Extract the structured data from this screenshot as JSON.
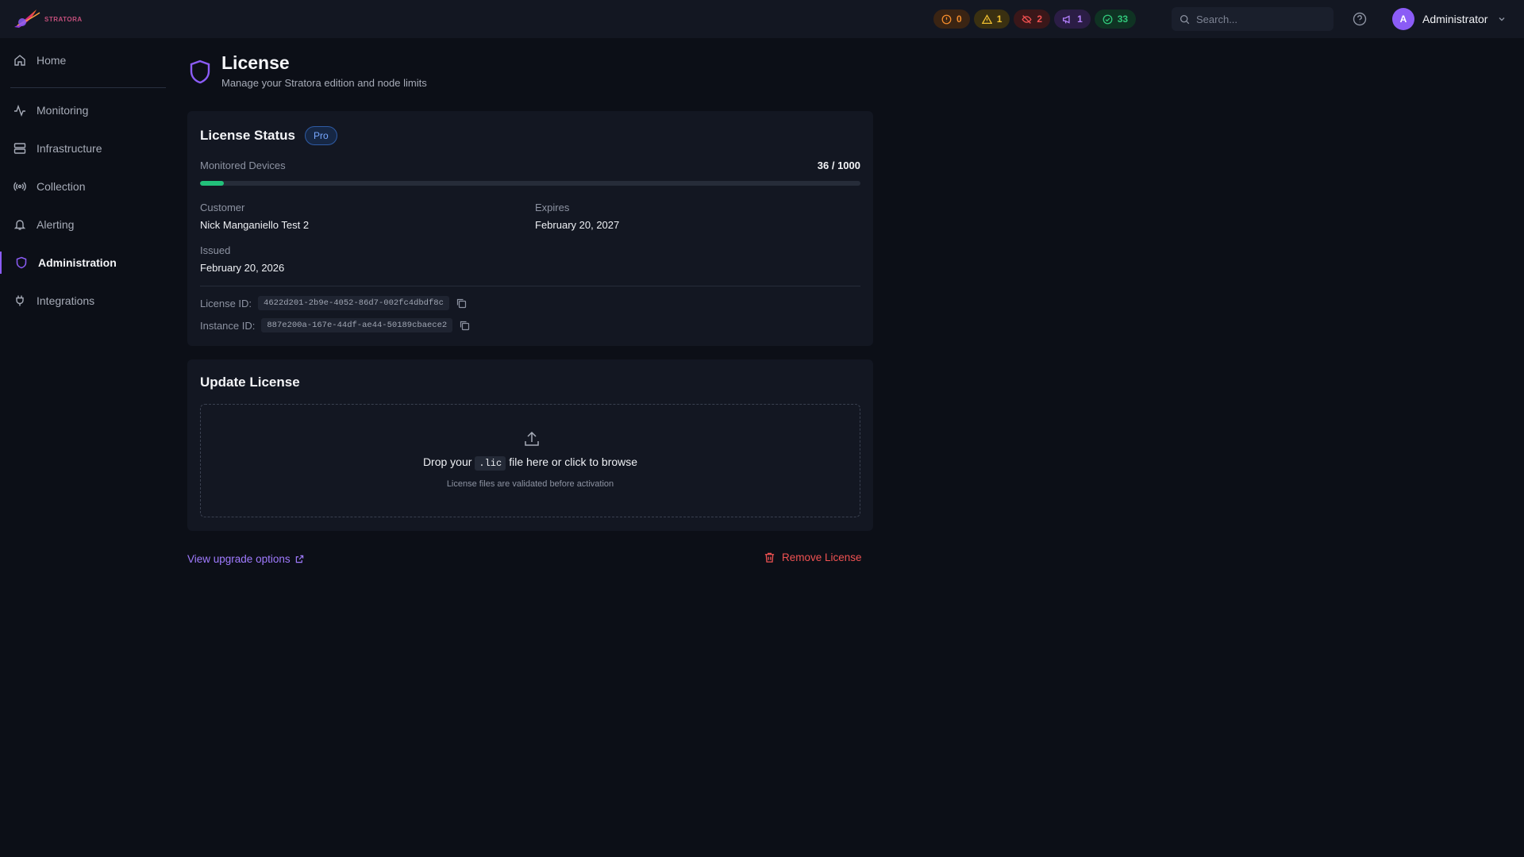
{
  "app": {
    "brand": "STRATORA"
  },
  "header": {
    "counters": [
      {
        "icon": "alert-circle-icon",
        "value": "0",
        "color": "#f08a2c"
      },
      {
        "icon": "warning-triangle-icon",
        "value": "1",
        "color": "#f0c030"
      },
      {
        "icon": "eye-off-icon",
        "value": "2",
        "color": "#f05050"
      },
      {
        "icon": "megaphone-icon",
        "value": "1",
        "color": "#b481ff"
      },
      {
        "icon": "check-circle-icon",
        "value": "33",
        "color": "#31c77a"
      }
    ],
    "search_placeholder": "Search...",
    "user": {
      "initial": "A",
      "name": "Administrator"
    }
  },
  "sidebar": {
    "items": [
      {
        "label": "Home",
        "icon": "home-icon"
      },
      {
        "label": "Monitoring",
        "icon": "activity-icon"
      },
      {
        "label": "Infrastructure",
        "icon": "server-icon"
      },
      {
        "label": "Collection",
        "icon": "broadcast-icon"
      },
      {
        "label": "Alerting",
        "icon": "bell-icon"
      },
      {
        "label": "Administration",
        "icon": "shield-icon",
        "active": true
      },
      {
        "label": "Integrations",
        "icon": "plug-icon"
      }
    ]
  },
  "page": {
    "title": "License",
    "subtitle": "Manage your Stratora edition and node limits"
  },
  "license_status": {
    "title": "License Status",
    "edition_badge": "Pro",
    "devices_label": "Monitored Devices",
    "devices_count": "36 / 1000",
    "devices_used_fraction": 0.036,
    "customer_label": "Customer",
    "customer": "Nick Manganiello Test 2",
    "expires_label": "Expires",
    "expires": "February 20, 2027",
    "issued_label": "Issued",
    "issued": "February 20, 2026",
    "license_id_label": "License ID:",
    "license_id": "4622d201-2b9e-4052-86d7-002fc4dbdf8c",
    "instance_id_label": "Instance ID:",
    "instance_id": "887e200a-167e-44df-ae44-50189cbaece2"
  },
  "update_license": {
    "title": "Update License",
    "drop_prefix": "Drop your",
    "drop_ext": ".lic",
    "drop_suffix": "file here or click to browse",
    "drop_hint": "License files are validated before activation"
  },
  "footer": {
    "upgrade_link": "View upgrade options",
    "remove_button": "Remove License"
  },
  "colors": {
    "accent": "#8b5cf6",
    "progress": "#22c07a",
    "danger": "#f05252",
    "link": "#a07bff"
  }
}
